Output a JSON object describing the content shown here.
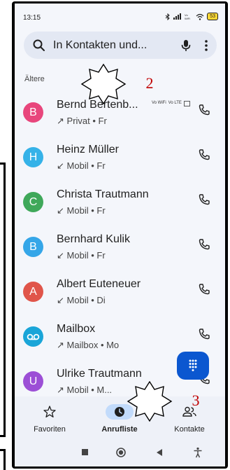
{
  "status_bar": {
    "time": "13:15",
    "battery": "53"
  },
  "search": {
    "text": "In Kontakten und..."
  },
  "section": {
    "label": "Ältere"
  },
  "calls": [
    {
      "initial": "B",
      "name": "Bernd Bertenb...",
      "direction": "↗",
      "detail": "Privat • Fr",
      "avatar_color": "#e8467c",
      "badges": [
        "Vo WiFi",
        "Vo LTE"
      ]
    },
    {
      "initial": "H",
      "name": "Heinz Müller",
      "direction": "↙",
      "detail": "Mobil • Fr",
      "avatar_color": "#35b2e8"
    },
    {
      "initial": "C",
      "name": "Christa Trautmann",
      "direction": "↙",
      "detail": "Mobil • Fr",
      "avatar_color": "#3fa85a"
    },
    {
      "initial": "B",
      "name": "Bernhard Kulik",
      "direction": "↙",
      "detail": "Mobil • Fr",
      "avatar_color": "#35a6e8"
    },
    {
      "initial": "A",
      "name": "Albert Euteneuer",
      "direction": "↙",
      "detail": "Mobil • Di",
      "avatar_color": "#e0554a"
    },
    {
      "initial": "",
      "name": "Mailbox",
      "direction": "↗",
      "detail": "Mailbox • Mo",
      "avatar_color": "#1aa5d8"
    },
    {
      "initial": "U",
      "name": "Ulrike Trautmann",
      "direction": "↗",
      "detail": "Mobil • M...",
      "avatar_color": "#9c4fd6"
    }
  ],
  "nav": {
    "favorites": "Favoriten",
    "recents": "Anrufliste",
    "contacts": "Kontakte"
  },
  "annotations": {
    "top": "2",
    "bottom": "3"
  },
  "colors": {
    "accent": "#0b57d0",
    "annotation": "#c00000"
  }
}
